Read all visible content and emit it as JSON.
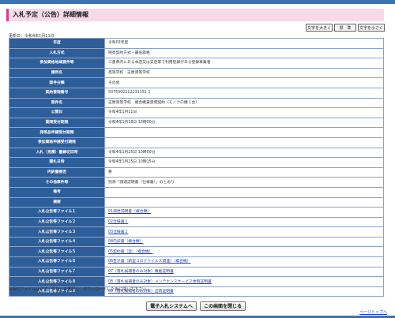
{
  "page": {
    "title": "入札予定（公告）詳細情報",
    "updated": "更新日：令和4年1月11日",
    "note": "※添付ファイルは必ず「保存」を選択し、ダウンロードした後に開いて下さい。",
    "page_top": "ページトップへ"
  },
  "font_size_buttons": [
    "文字を大きく",
    "標　準",
    "文字を小さく"
  ],
  "rows": [
    {
      "label": "年度",
      "value": "令和03年度"
    },
    {
      "label": "入札方式",
      "value": "随意契約方式・最低価格"
    },
    {
      "label": "参加資格地域要件等",
      "value": "三重県内にある本店又は支店等で利用登録がある登録事業者"
    },
    {
      "label": "課所名",
      "value": "高等学校　志摩高等学校"
    },
    {
      "label": "案件分類",
      "value": "その他"
    },
    {
      "label": "契約管理番号",
      "value": "5075502112231151 1"
    },
    {
      "label": "案件名",
      "value": "志摩高等学校　複合機賃貸借契約（モノクロ機１台）"
    },
    {
      "label": "公開日",
      "value": "令和4年1月11日"
    },
    {
      "label": "質問受付期限",
      "value": "令和4年1月18日 13時00分"
    },
    {
      "label": "発等品申請受付期限",
      "value": ""
    },
    {
      "label": "参加資格申請受付期限",
      "value": ""
    },
    {
      "label": "入札（見積）書締切日時",
      "value": "令和4年1月25日 10時00分"
    },
    {
      "label": "開札日時",
      "value": "令和4年1月25日 10時15分"
    },
    {
      "label": "内訳書要否",
      "value": "要"
    },
    {
      "label": "その他事件等",
      "value": "別添「調達説明書（仕様書）」のとおり"
    },
    {
      "label": "備考",
      "value": ""
    },
    {
      "label": "摘要",
      "value": ""
    },
    {
      "label": "入札公告等ファイル１",
      "value": "01調達説明書（複合機）",
      "link": true
    },
    {
      "label": "入札公告等ファイル２",
      "value": "02仕様書１",
      "link": true
    },
    {
      "label": "入札公告等ファイル３",
      "value": "03仕様書２",
      "link": true
    },
    {
      "label": "入札公告等ファイル４",
      "value": "04内訳書（複合機）",
      "link": true
    },
    {
      "label": "入札公告等ファイル５",
      "value": "05契約書（案）（複合機）",
      "link": true
    },
    {
      "label": "入札公告等ファイル６",
      "value": "06告示書（新型コロナウイルス関連）（複合機）",
      "link": true
    },
    {
      "label": "入札公告等ファイル７",
      "value": "07（落札候補者のみ対象）機能証明書",
      "link": true
    },
    {
      "label": "入札公告等ファイル８",
      "value": "08（落札候補者のみ対象）メンテナンスサービス体制証明書",
      "link": true
    },
    {
      "label": "入札公告等ファイル９",
      "value": "09（落札候補者のみ対象）出荷証明書",
      "link": true
    }
  ],
  "buttons": {
    "system": "電子入札システムへ",
    "close": "この画面を閉じる"
  }
}
